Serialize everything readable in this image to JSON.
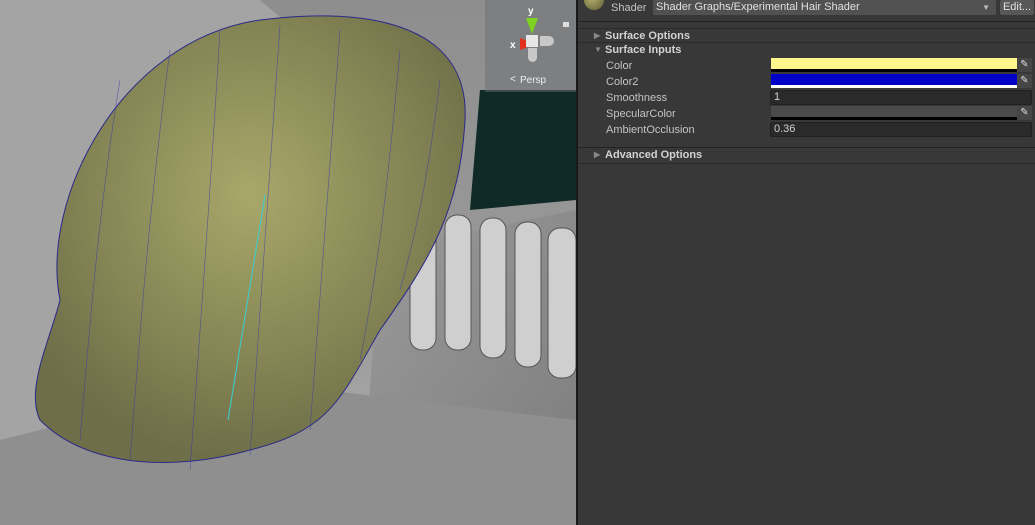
{
  "viewport": {
    "projection_label": "Persp",
    "gizmo": {
      "y_label": "y",
      "x_label": "x"
    }
  },
  "inspector": {
    "shader_label": "Shader",
    "shader_value": "Shader Graphs/Experimental Hair Shader",
    "edit_button": "Edit...",
    "sections": {
      "surface_options": "Surface Options",
      "surface_inputs": "Surface Inputs",
      "advanced_options": "Advanced Options"
    },
    "properties": [
      {
        "label": "Color",
        "type": "color",
        "value": "#fff68c"
      },
      {
        "label": "Color2",
        "type": "color",
        "value": "#0000c8"
      },
      {
        "label": "Smoothness",
        "type": "float",
        "value": "1"
      },
      {
        "label": "SpecularColor",
        "type": "color",
        "value": "#4a4a4a"
      },
      {
        "label": "AmbientOcclusion",
        "type": "float",
        "value": "0.36"
      }
    ]
  }
}
